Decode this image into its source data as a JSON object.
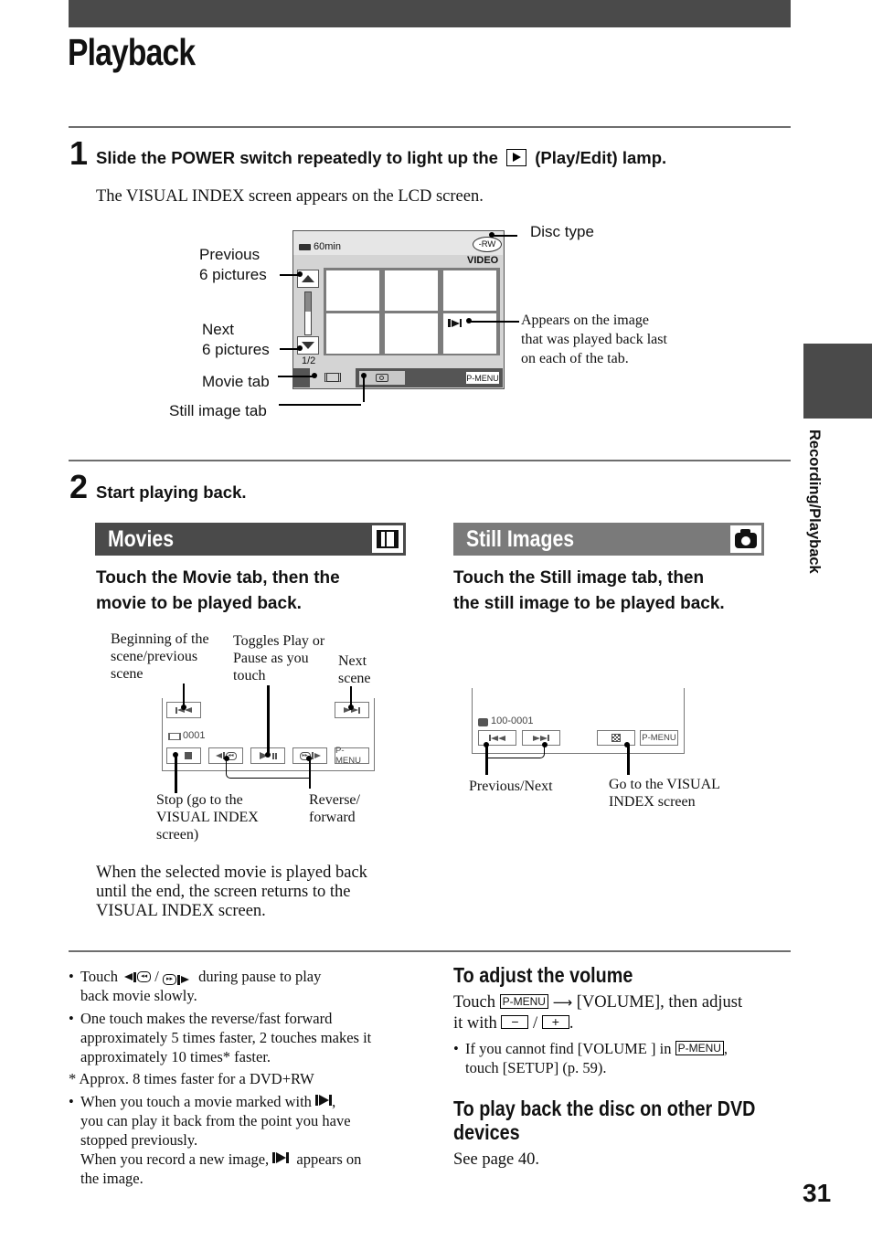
{
  "page": {
    "title": "Playback",
    "side_tab_label": "Recording/Playback",
    "page_number": "31"
  },
  "step1": {
    "number": "1",
    "instruction_before": "Slide the POWER switch repeatedly to light up the",
    "instruction_icon": "play-edit-lamp-icon",
    "instruction_after": "(Play/Edit) lamp.",
    "description": "The VISUAL INDEX screen appears on the LCD screen.",
    "lcd": {
      "battery_text": "60min",
      "disc_badge": "-RW",
      "mode_label": "VIDEO",
      "page_indicator": "1/2",
      "pmenu_label": "P-MENU",
      "resume_marker_icon": "resume-mark-icon",
      "thumbnail_count": 6
    },
    "callouts": {
      "previous_line1": "Previous",
      "previous_line2": "6 pictures",
      "next_line1": "Next",
      "next_line2": "6 pictures",
      "movie_tab": "Movie tab",
      "still_tab": "Still image tab",
      "disc_type": "Disc type",
      "appears_1": "Appears on the image",
      "appears_2": "that was played back last",
      "appears_3": "on each of the tab."
    }
  },
  "step2": {
    "number": "2",
    "instruction": "Start playing back.",
    "movies": {
      "title": "Movies",
      "icon": "film-icon",
      "bar_color": "#4a4a4a",
      "heading_line1": "Touch the Movie tab, then the",
      "heading_line2": "movie to be played back.",
      "screen": {
        "counter": "0001",
        "pmenu_label": "P-MENU"
      },
      "callouts": {
        "beginning_1": "Beginning of the",
        "beginning_2": "scene/previous",
        "beginning_3": "scene",
        "toggle_1": "Toggles Play or",
        "toggle_2": "Pause as you",
        "toggle_3": "touch",
        "next_1": "Next",
        "next_2": "scene",
        "stop_1": "Stop (go to the",
        "stop_2": "VISUAL INDEX",
        "stop_3": "screen)",
        "reverse_1": "Reverse/",
        "reverse_2": "forward"
      },
      "note_1": "When the selected movie is played back",
      "note_2": "until the end, the screen returns to the",
      "note_3": "VISUAL INDEX screen."
    },
    "stills": {
      "title": "Still Images",
      "icon": "camera-icon",
      "bar_color": "#7a7a7a",
      "heading_line1": "Touch the Still image tab, then",
      "heading_line2": "the still image to be played back.",
      "screen": {
        "counter": "100-0001",
        "pmenu_label": "P-MENU"
      },
      "callouts": {
        "prev_next": "Previous/Next",
        "goto_1": "Go to the VISUAL",
        "goto_2": "INDEX screen"
      }
    }
  },
  "notes": {
    "bullet1_before": "Touch",
    "bullet1_sep": "/",
    "bullet1_after": "during pause to play",
    "bullet1_line2": "back movie slowly.",
    "bullet2_line1": "One touch makes the reverse/fast forward",
    "bullet2_line2": "approximately 5 times faster, 2 touches makes it",
    "bullet2_line3": "approximately 10 times* faster.",
    "footnote": "* Approx. 8 times faster for a DVD+RW",
    "bullet3_line1_before": "When you touch a movie marked with",
    "bullet3_line1_after": ",",
    "bullet3_line2": "you can play it back from the point you have",
    "bullet3_line3": "stopped previously.",
    "bullet3_line4_before": "When you record a new image,",
    "bullet3_line4_after": "appears on",
    "bullet3_line5": "the image."
  },
  "volume": {
    "heading": "To adjust the volume",
    "line1_before": "Touch",
    "pmenu_key": "P-MENU",
    "line1_after": "[VOLUME], then adjust",
    "line2_before": "it with",
    "minus_key": "−",
    "sep": "/",
    "plus_key": "+",
    "line2_after": ".",
    "bullet_before": "If you cannot find [VOLUME ] in",
    "bullet_after": ",",
    "bullet_line2": "touch [SETUP] (p. 59)."
  },
  "other_devices": {
    "heading_line1": "To play back the disc on other DVD",
    "heading_line2": "devices",
    "text": "See page 40."
  }
}
